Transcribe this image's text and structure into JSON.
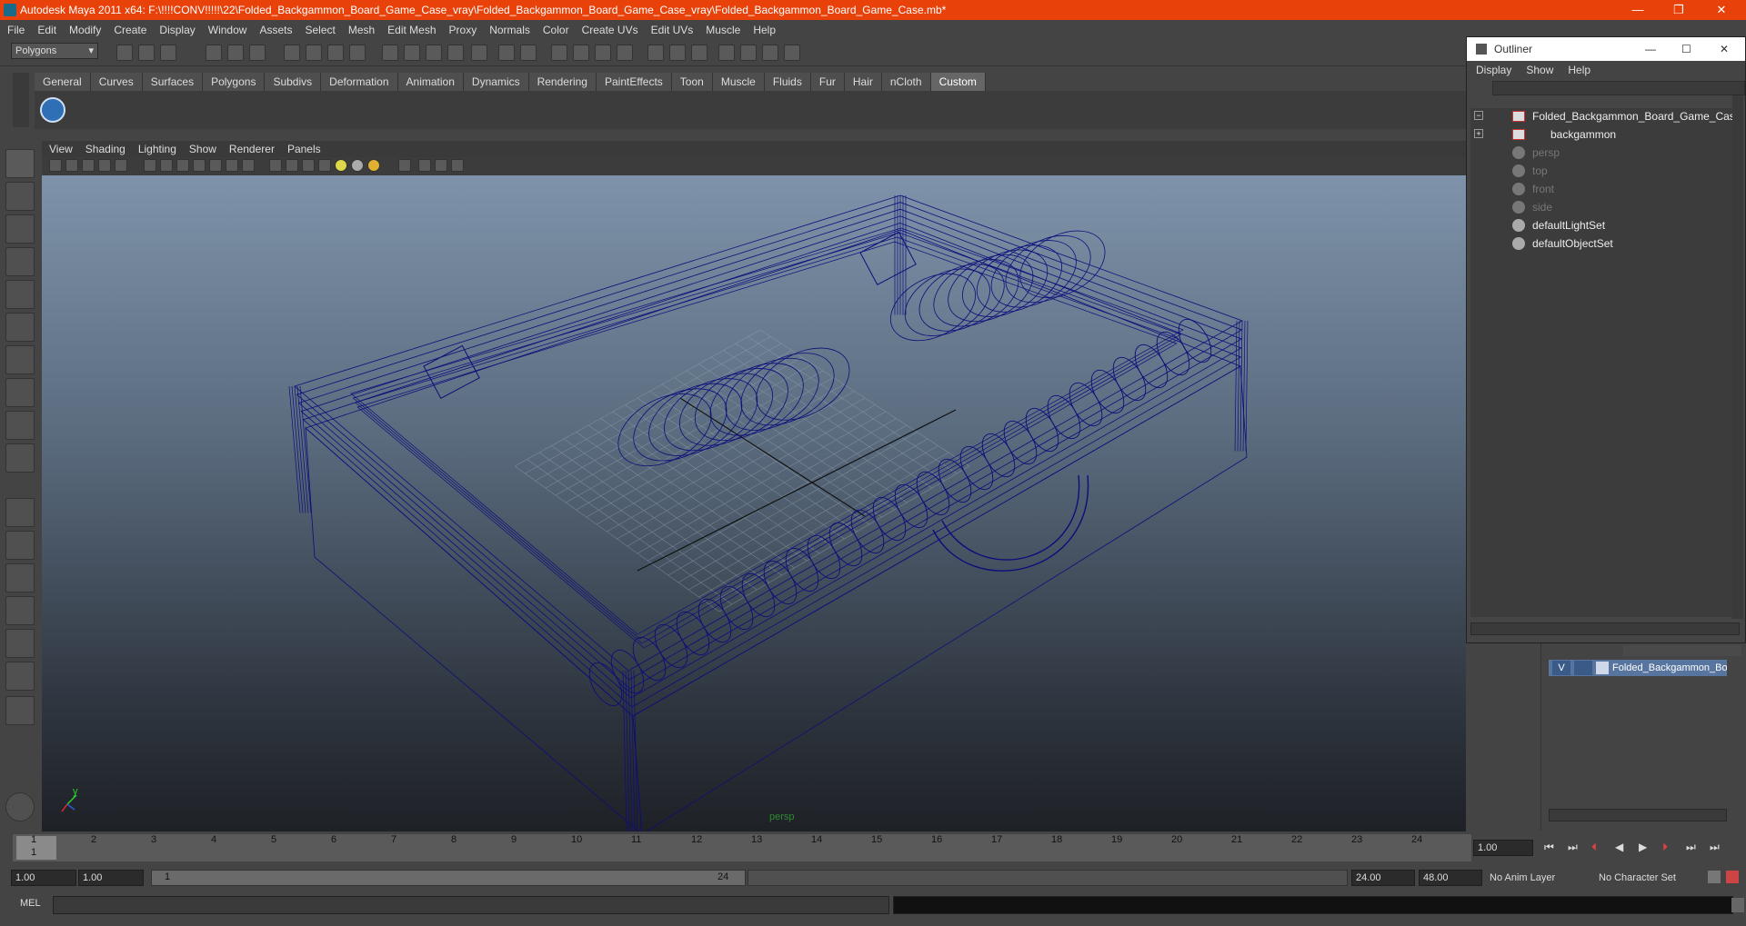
{
  "window": {
    "title": "Autodesk Maya 2011 x64: F:\\!!!!CONV!!!!!\\22\\Folded_Backgammon_Board_Game_Case_vray\\Folded_Backgammon_Board_Game_Case_vray\\Folded_Backgammon_Board_Game_Case.mb*",
    "minimize": "—",
    "restore": "❐",
    "close": "✕"
  },
  "menubar": [
    "File",
    "Edit",
    "Modify",
    "Create",
    "Display",
    "Window",
    "Assets",
    "Select",
    "Mesh",
    "Edit Mesh",
    "Proxy",
    "Normals",
    "Color",
    "Create UVs",
    "Edit UVs",
    "Muscle",
    "Help"
  ],
  "mode_selector": "Polygons",
  "shelf_tabs": [
    "General",
    "Curves",
    "Surfaces",
    "Polygons",
    "Subdivs",
    "Deformation",
    "Animation",
    "Dynamics",
    "Rendering",
    "PaintEffects",
    "Toon",
    "Muscle",
    "Fluids",
    "Fur",
    "Hair",
    "nCloth",
    "Custom"
  ],
  "active_shelf": "Custom",
  "viewport": {
    "menu": [
      "View",
      "Shading",
      "Lighting",
      "Show",
      "Renderer",
      "Panels"
    ],
    "camera_label": "persp",
    "wire_color": "#0d0d7a",
    "axis_y": "y"
  },
  "outliner": {
    "title": "Outliner",
    "menu": [
      "Display",
      "Show",
      "Help"
    ],
    "items": [
      {
        "label": "Folded_Backgammon_Board_Game_Case",
        "dim": false
      },
      {
        "label": "backgammon",
        "dim": false
      },
      {
        "label": "persp",
        "dim": true
      },
      {
        "label": "top",
        "dim": true
      },
      {
        "label": "front",
        "dim": true
      },
      {
        "label": "side",
        "dim": true
      },
      {
        "label": "defaultLightSet",
        "dim": false
      },
      {
        "label": "defaultObjectSet",
        "dim": false
      }
    ]
  },
  "layer": {
    "visibility": "V",
    "name": "Folded_Backgammon_Boa"
  },
  "timeline": {
    "ticks": [
      "1",
      "2",
      "3",
      "4",
      "5",
      "6",
      "7",
      "8",
      "9",
      "10",
      "11",
      "12",
      "13",
      "14",
      "15",
      "16",
      "17",
      "18",
      "19",
      "20",
      "21",
      "22",
      "23",
      "24"
    ],
    "current_frame": "1.00",
    "cursor_label": "1"
  },
  "range": {
    "start": "1.00",
    "playback_start": "1.00",
    "slider_start": "1",
    "slider_end": "24",
    "playback_end": "24.00",
    "end": "48.00",
    "anim_layer": "No Anim Layer",
    "character_set": "No Character Set"
  },
  "command": {
    "label": "MEL"
  }
}
